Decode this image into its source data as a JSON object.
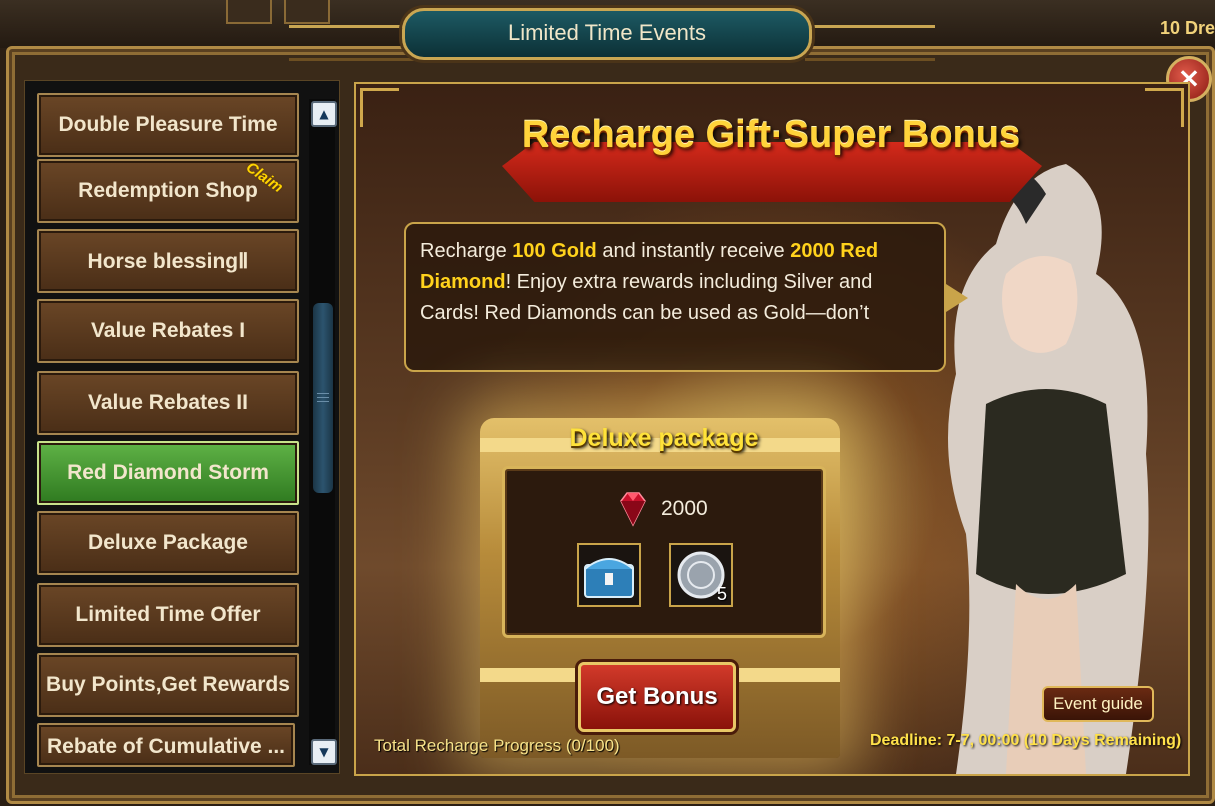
{
  "window": {
    "title": "Limited Time Events",
    "close_label": "×"
  },
  "top_strip": {
    "right_text": "10 Dre"
  },
  "sidebar": {
    "items": [
      {
        "label": "Double Pleasure Time",
        "active": false
      },
      {
        "label": "Redemption Shop",
        "active": false,
        "badge": "Claim"
      },
      {
        "label": "Horse blessingⅡ",
        "active": false
      },
      {
        "label": "Value Rebates I",
        "active": false
      },
      {
        "label": "Value Rebates II",
        "active": false
      },
      {
        "label": "Red Diamond Storm",
        "active": true
      },
      {
        "label": "Deluxe Package",
        "active": false
      },
      {
        "label": "Limited Time Offer",
        "active": false
      },
      {
        "label": "Buy Points,Get Rewards",
        "active": false
      },
      {
        "label": "Rebate of Cumulative ...",
        "active": false
      }
    ],
    "scroll_up": "▲",
    "scroll_down": "▼"
  },
  "event": {
    "banner_title": "Recharge Gift·Super Bonus",
    "description": {
      "part1": "Recharge ",
      "highlight1": "100 Gold",
      "part2": " and instantly receive ",
      "highlight2": "2000 Red Diamond",
      "part3": "! Enjoy extra rewards including Silver and Cards! Red Diamonds can be used as Gold—don’t"
    },
    "package": {
      "title": "Deluxe package",
      "gem_amount": "2000",
      "items": [
        {
          "icon": "treasure-chest-icon",
          "count": ""
        },
        {
          "icon": "silver-coin-icon",
          "count": "5"
        }
      ]
    },
    "get_bonus_label": "Get Bonus",
    "progress_text": "Total Recharge Progress (0/100)",
    "deadline_text": "Deadline: 7-7, 00:00 (10 Days Remaining)",
    "event_guide_label": "Event guide"
  },
  "colors": {
    "accent_gold": "#ffd21c",
    "active_green": "#4e9e36",
    "button_red": "#b81f14"
  }
}
